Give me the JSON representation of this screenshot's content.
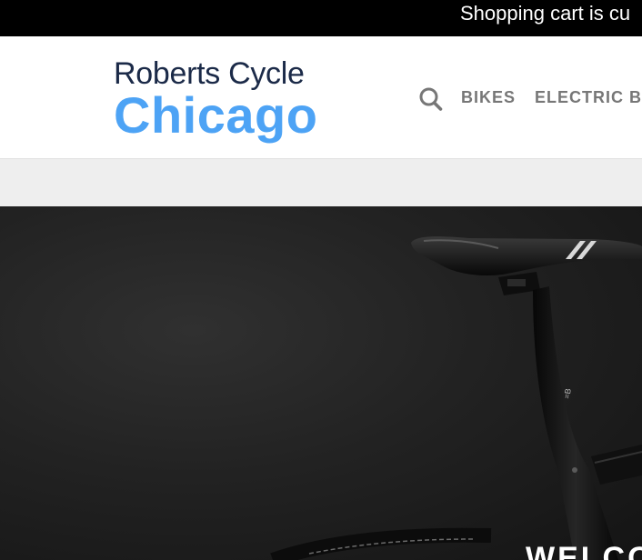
{
  "announcement": {
    "text": "Shopping cart is cu"
  },
  "header": {
    "logo": {
      "line1": "Roberts Cycle",
      "line2": "Chicago"
    },
    "search_icon": "search-icon",
    "nav": [
      {
        "label": "BIKES"
      },
      {
        "label": "ELECTRIC B"
      }
    ]
  },
  "hero": {
    "heading": "WELCO"
  },
  "colors": {
    "announcement_bg": "#000000",
    "logo_primary": "#1b2a48",
    "logo_accent": "#4da3f5",
    "nav_text": "#777777",
    "subbar_bg": "#eeeeee",
    "hero_bg": "#1e1e1e"
  }
}
